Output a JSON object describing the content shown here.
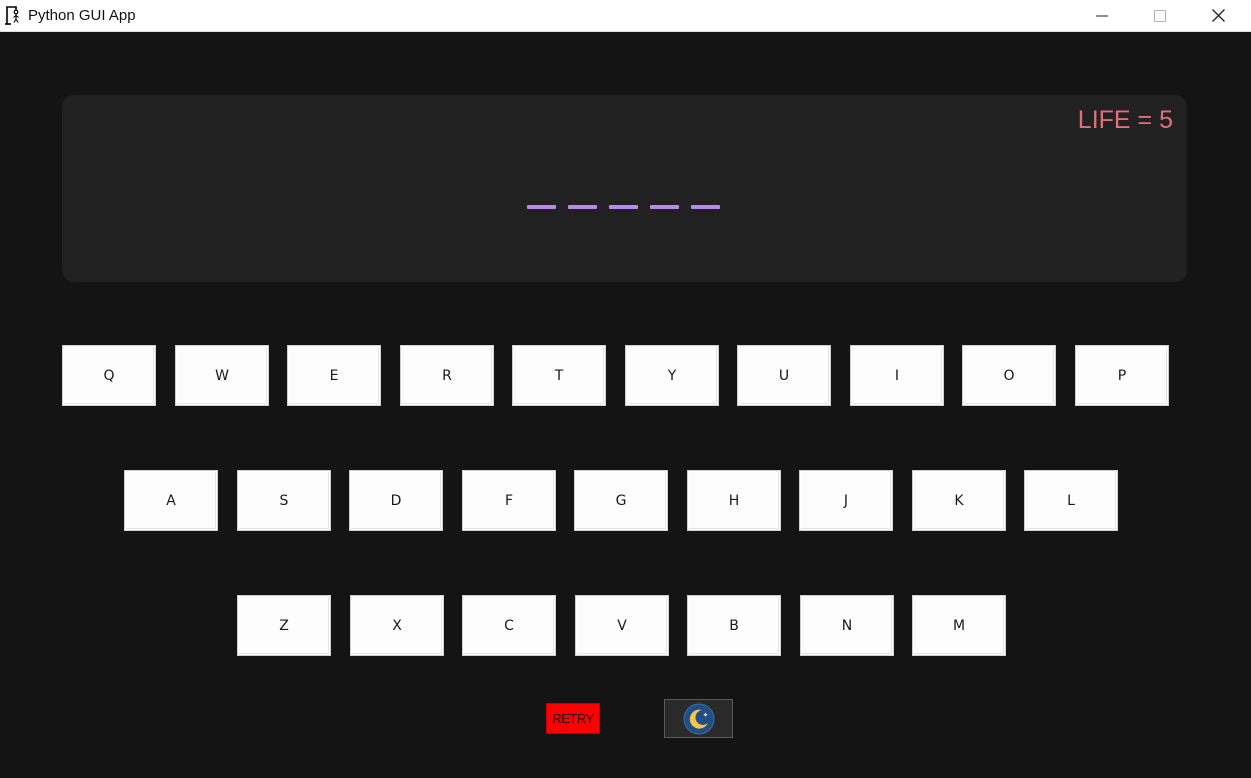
{
  "window": {
    "title": "Python GUI App"
  },
  "game": {
    "life_text": "LIFE = 5",
    "word_slots": 5
  },
  "keyboard": {
    "rows": [
      [
        "Q",
        "W",
        "E",
        "R",
        "T",
        "Y",
        "U",
        "I",
        "O",
        "P"
      ],
      [
        "A",
        "S",
        "D",
        "F",
        "G",
        "H",
        "J",
        "K",
        "L"
      ],
      [
        "Z",
        "X",
        "C",
        "V",
        "B",
        "N",
        "M"
      ]
    ]
  },
  "controls": {
    "retry_label": "RETRY",
    "theme_icon": "moon-icon"
  },
  "colors": {
    "background": "#141414",
    "panel": "#212121",
    "life": "#e0707a",
    "dash": "#b48af0",
    "retry": "#ff0000"
  }
}
